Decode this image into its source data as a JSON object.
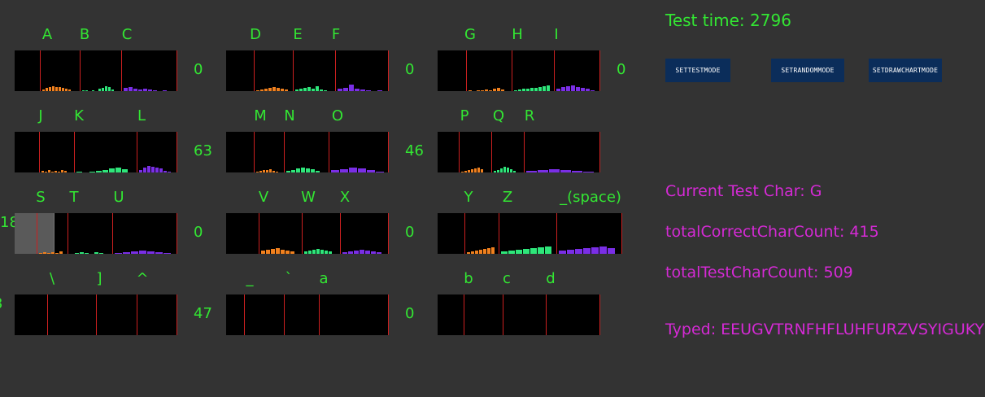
{
  "header": {
    "test_time_label": "Test time:",
    "test_time_value": "2796"
  },
  "buttons": [
    {
      "label": "SETTESTMODE"
    },
    {
      "label": "SETRANDOMMODE"
    },
    {
      "label": "SETDRAWCHARTMODE"
    }
  ],
  "stats": {
    "current_test_char": "Current Test Char: G",
    "total_correct": "totalCorrectCharCount: 415",
    "total_test": "totalTestCharCount: 509",
    "typed": "Typed: EEUGVTRNFHFLUHFURZVSYIGUKYDKYE"
  },
  "edge_labels": {
    "row3_left": "18",
    "row4_left": "3"
  },
  "colors": {
    "background": "#333333",
    "label_green": "#33e633",
    "stat_magenta": "#d52ad5",
    "divider_red": "#cc2020",
    "bar_orange": "#f0801e",
    "bar_green": "#2ee67a",
    "bar_purple": "#7a2ee6",
    "button_bg": "#0b2d5a"
  },
  "panels": [
    {
      "chars": [
        "A",
        "B",
        "C"
      ],
      "count": "0",
      "levels": [
        [
          2,
          4,
          5,
          6,
          5,
          5,
          4,
          3,
          2
        ],
        [
          1,
          1,
          0,
          1,
          0,
          3,
          4,
          6,
          5,
          2
        ],
        [
          4,
          5,
          3,
          2,
          3,
          2,
          1,
          0,
          1
        ]
      ]
    },
    {
      "chars": [
        "D",
        "E",
        "F"
      ],
      "count": "0",
      "levels": [
        [
          1,
          2,
          3,
          4,
          5,
          4,
          3,
          2
        ],
        [
          2,
          3,
          4,
          5,
          3,
          6,
          2,
          1
        ],
        [
          3,
          4,
          8,
          3,
          2,
          1,
          0,
          1
        ]
      ]
    },
    {
      "chars": [
        "G",
        "H",
        "I"
      ],
      "count": "0",
      "levels": [
        [
          1,
          0,
          1,
          1,
          2,
          1,
          3,
          4,
          2
        ],
        [
          1,
          2,
          3,
          3,
          4,
          4,
          5,
          6,
          7
        ],
        [
          3,
          5,
          6,
          7,
          5,
          4,
          3,
          1
        ]
      ]
    },
    {
      "chars": [
        "J",
        "K",
        "L"
      ],
      "count": "63",
      "levels": [
        [
          2,
          1,
          3,
          1,
          2,
          1,
          3,
          2
        ],
        [
          1,
          0,
          1,
          2,
          3,
          5,
          6,
          4
        ],
        [
          3,
          6,
          8,
          7,
          6,
          5,
          2,
          1
        ]
      ]
    },
    {
      "chars": [
        "M",
        "N",
        "O"
      ],
      "count": "46",
      "levels": [
        [
          1,
          2,
          3,
          3,
          4,
          2,
          1
        ],
        [
          2,
          3,
          5,
          6,
          5,
          4,
          2
        ],
        [
          3,
          4,
          6,
          5,
          3,
          1
        ]
      ]
    },
    {
      "chars": [
        "P",
        "Q",
        "R"
      ],
      "count": "",
      "levels": [
        [
          1,
          2,
          3,
          4,
          5,
          6,
          4
        ],
        [
          2,
          3,
          5,
          7,
          6,
          4,
          2
        ],
        [
          2,
          3,
          4,
          3,
          2,
          1
        ]
      ]
    },
    {
      "chars": [
        "S",
        "T",
        "U"
      ],
      "count": "0",
      "levels": [
        [
          1,
          2,
          1,
          2,
          1,
          3
        ],
        [
          0,
          1,
          2,
          1,
          0,
          2,
          1
        ],
        [
          1,
          2,
          3,
          4,
          3,
          2,
          1
        ]
      ],
      "highlight": true
    },
    {
      "chars": [
        "V",
        "W",
        "X"
      ],
      "count": "0",
      "levels": [
        [
          4,
          5,
          6,
          7,
          5,
          4,
          3
        ],
        [
          3,
          4,
          5,
          6,
          5,
          4,
          3
        ],
        [
          2,
          3,
          4,
          5,
          4,
          3,
          2
        ]
      ]
    },
    {
      "chars": [
        "Y",
        "Z",
        "_(space)"
      ],
      "count": "",
      "levels": [
        [
          2,
          3,
          4,
          5,
          6,
          7,
          8
        ],
        [
          3,
          4,
          5,
          6,
          7,
          8,
          9
        ],
        [
          4,
          5,
          6,
          7,
          8,
          9,
          7
        ]
      ]
    },
    {
      "chars": [
        "\\",
        "]",
        "^"
      ],
      "count": "47",
      "levels": [
        [],
        [],
        []
      ]
    },
    {
      "chars": [
        "_",
        "`",
        "a"
      ],
      "count": "0",
      "levels": [
        [],
        [],
        []
      ]
    },
    {
      "chars": [
        "b",
        "c",
        "d"
      ],
      "count": "",
      "levels": [
        [],
        [],
        []
      ]
    }
  ]
}
